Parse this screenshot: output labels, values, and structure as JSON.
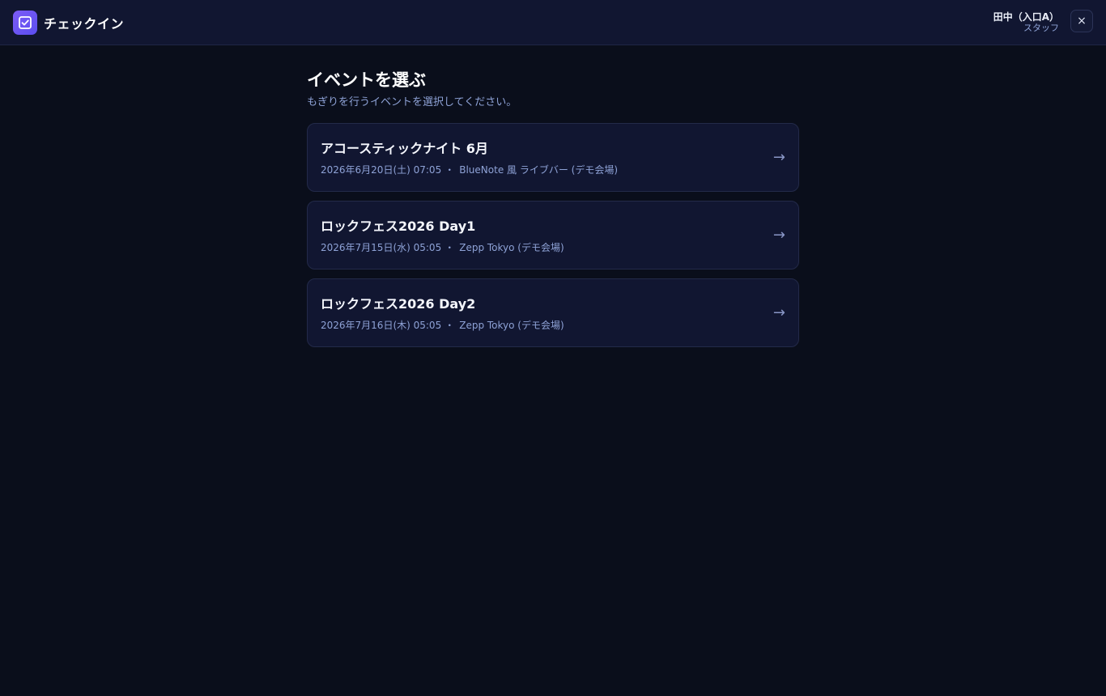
{
  "header": {
    "app_title": "チェックイン",
    "user_name": "田中（入口A）",
    "user_role": "スタッフ",
    "close_label": "×",
    "brand_icon": "check-square-icon"
  },
  "main": {
    "title": "イベントを選ぶ",
    "subtitle": "もぎりを行うイベントを選択してください。"
  },
  "events": [
    {
      "title": "アコースティックナイト 6月",
      "datetime": "2026年6月20日(土) 07:05",
      "separator": "・",
      "venue": "BlueNote 風 ライブバー (デモ会場)",
      "arrow": "→"
    },
    {
      "title": "ロックフェス2026 Day1",
      "datetime": "2026年7月15日(水) 05:05",
      "separator": "・",
      "venue": "Zepp Tokyo (デモ会場)",
      "arrow": "→"
    },
    {
      "title": "ロックフェス2026 Day2",
      "datetime": "2026年7月16日(木) 05:05",
      "separator": "・",
      "venue": "Zepp Tokyo (デモ会場)",
      "arrow": "→"
    }
  ],
  "colors": {
    "background": "#0a0e1b",
    "surface": "#111631",
    "accent": "#6a55f3",
    "muted_text": "#8ea2d6"
  }
}
